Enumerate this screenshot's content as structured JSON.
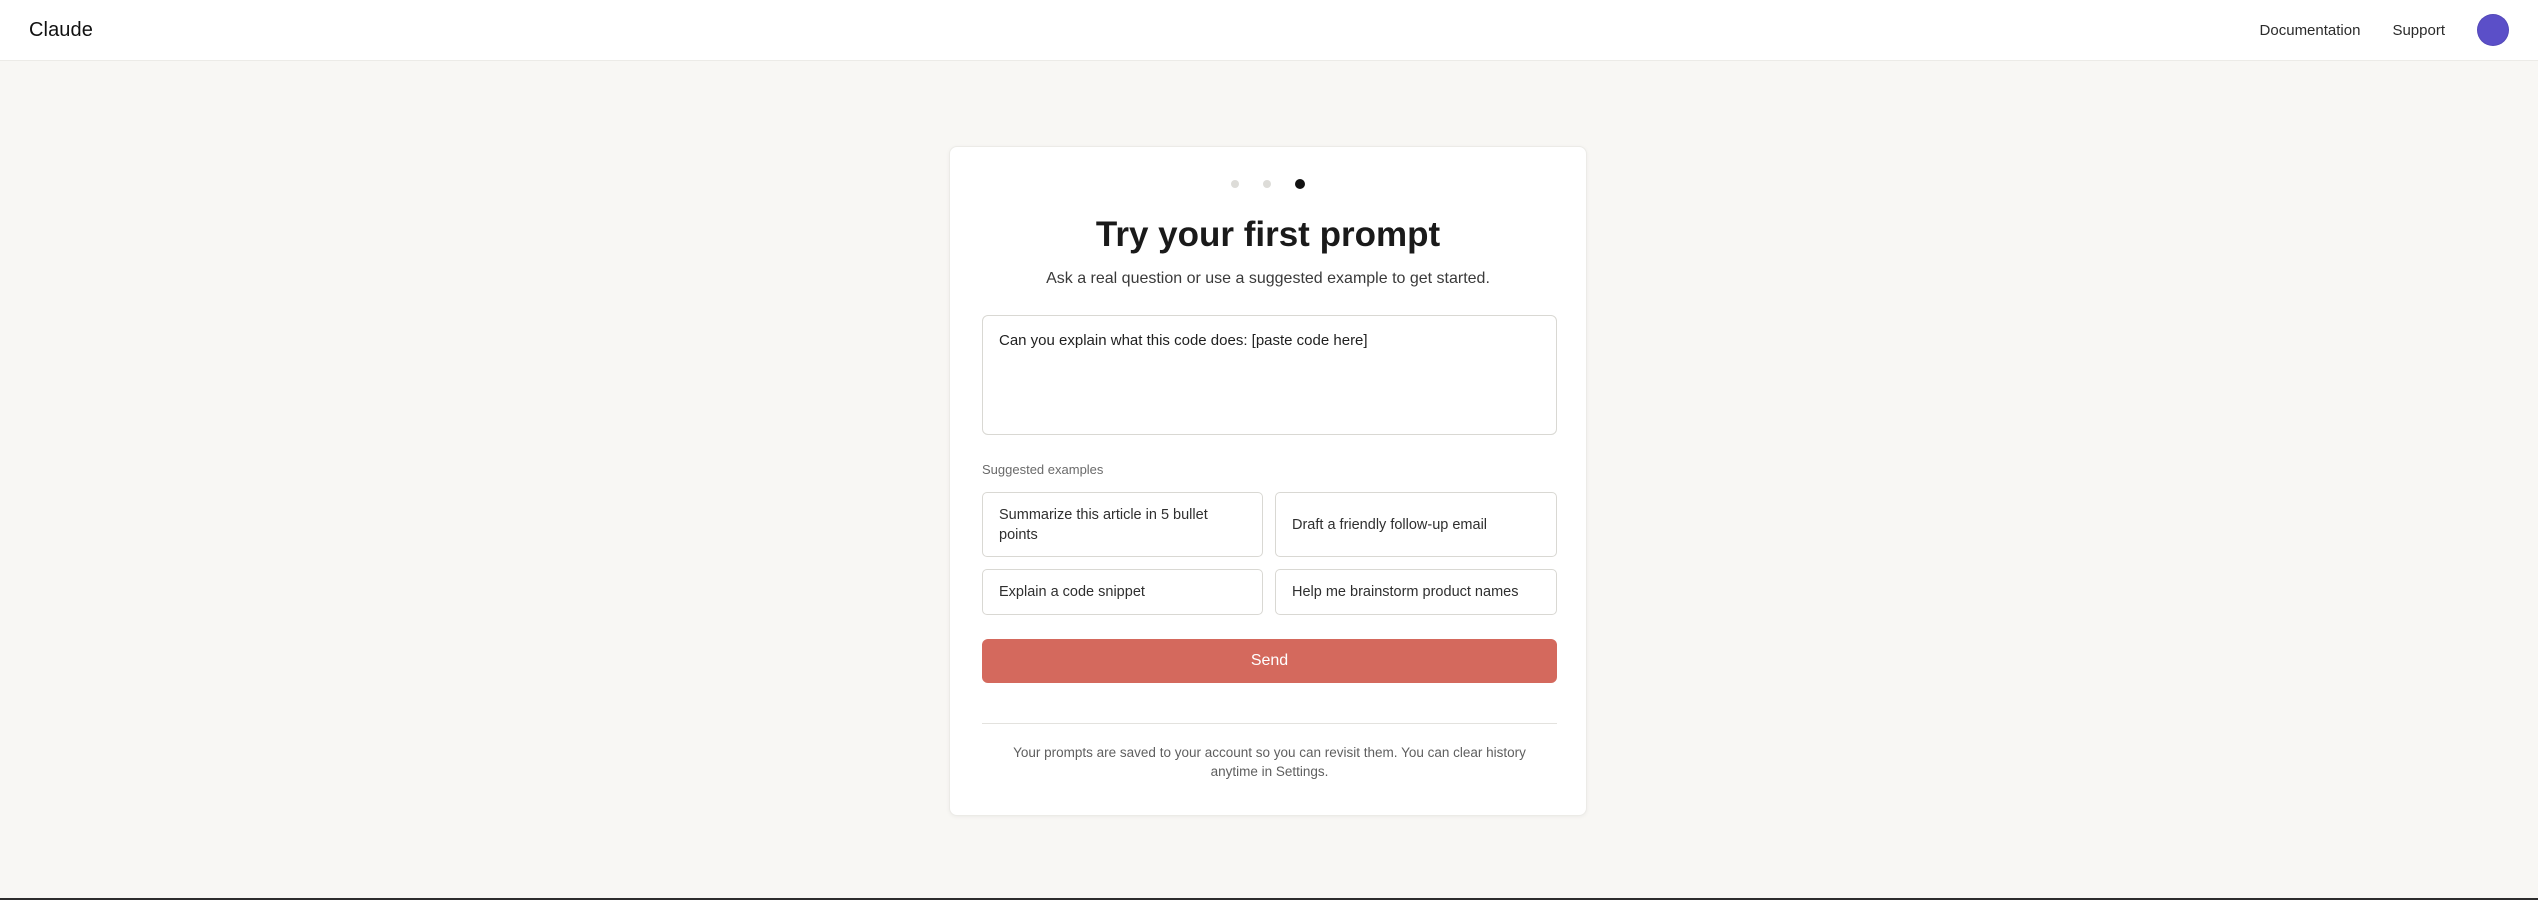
{
  "header": {
    "brand": "Claude",
    "nav": [
      "Documentation",
      "Support"
    ]
  },
  "onboarding": {
    "steps_total": 3,
    "current_step": 3,
    "title": "Try your first prompt",
    "subtitle": "Ask a real question or use a suggested example to get started.",
    "prompt_value": "Can you explain what this code does: [paste code here]",
    "suggested_label": "Suggested examples",
    "suggestions": [
      "Summarize this article in 5 bullet points",
      "Draft a friendly follow-up email",
      "Explain a code snippet",
      "Help me brainstorm product names"
    ],
    "send_label": "Send",
    "footnote": "Your prompts are saved to your account so you can revisit them. You can clear history anytime in Settings."
  },
  "colors": {
    "accent": "#d4695d",
    "avatar": "#5b4fc8",
    "background": "#f8f7f4"
  }
}
